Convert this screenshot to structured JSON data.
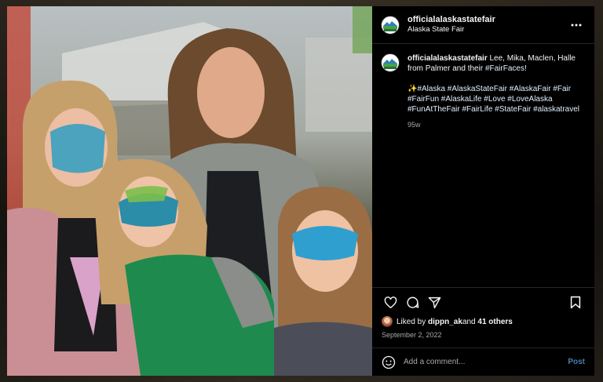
{
  "post": {
    "username": "officialalaskastatefair",
    "location": "Alaska State Fair",
    "caption_text": "Lee, Mika, Maclen, Halle from Palmer and their ",
    "caption_hashtag": "#FairFaces",
    "caption_end": "!",
    "hashtags_line": "✨#Alaska #AlaskaStateFair #AlaskaFair #Fair #FairFun #AlaskaLife #Love #LoveAlaska #FunAtTheFair #FairLife #StateFair #alaskatravel",
    "age": "95w",
    "liked_by_prefix": "Liked by ",
    "liked_by_user": "dippn_ak",
    "liked_by_mid": " and ",
    "liked_by_others": "41 others",
    "date": "September 2, 2022"
  },
  "comment": {
    "placeholder": "Add a comment...",
    "post_label": "Post"
  },
  "photo": {
    "description_alt": "Family with face paint at the fair"
  },
  "icons": {
    "more": "more-options-icon",
    "like": "heart-icon",
    "comment": "comment-bubble-icon",
    "share": "paper-plane-icon",
    "save": "bookmark-icon",
    "emoji": "emoji-icon"
  },
  "colors": {
    "background": "#000000",
    "text": "#f5f5f5",
    "muted": "#a8a8a8",
    "post_button": "#4a7fb0",
    "divider": "#262626"
  }
}
